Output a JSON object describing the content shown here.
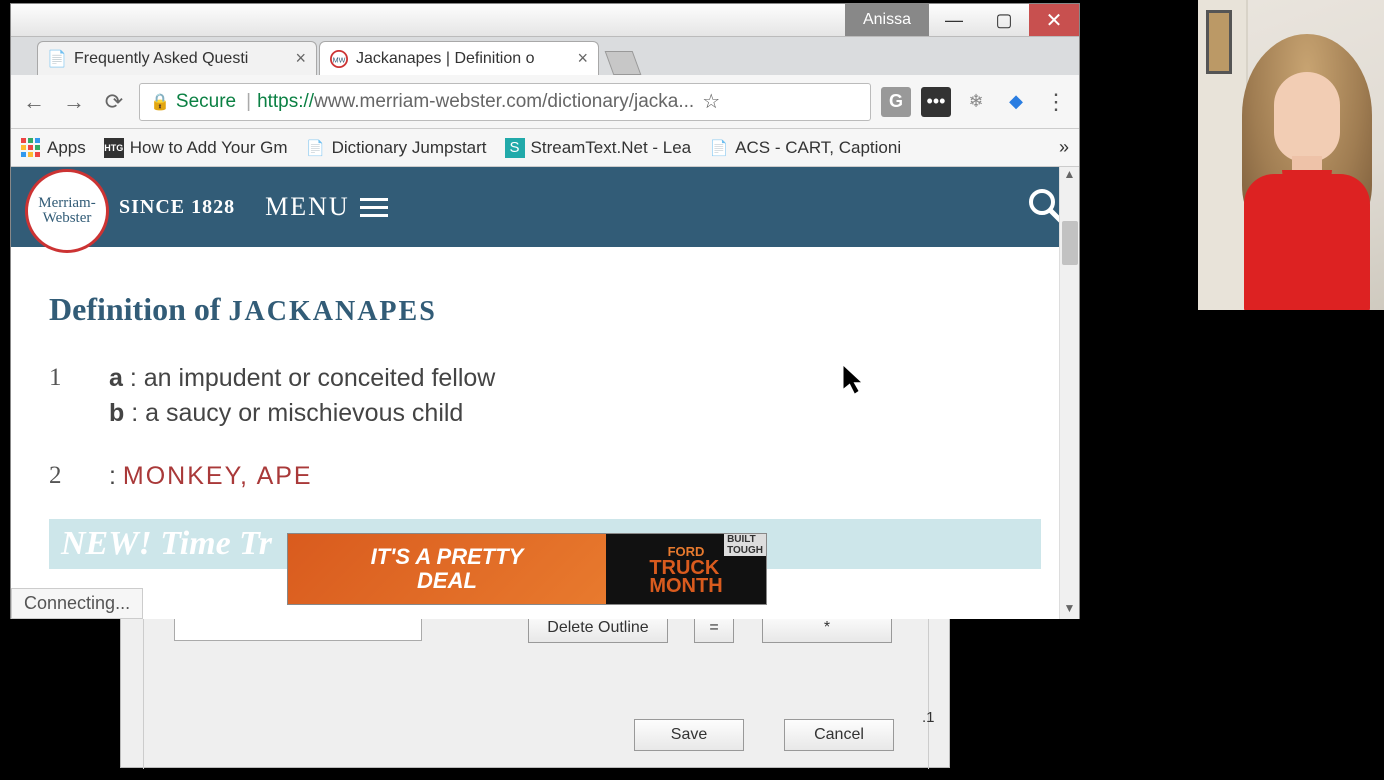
{
  "titlebar": {
    "profile": "Anissa"
  },
  "tabs": [
    {
      "label": "Frequently Asked Questi",
      "active": false
    },
    {
      "label": "Jackanapes | Definition o",
      "active": true
    }
  ],
  "address": {
    "secure_label": "Secure",
    "protocol": "https://",
    "url_rest": "www.merriam-webster.com/dictionary/jacka..."
  },
  "bookmarks": {
    "apps": "Apps",
    "items": [
      "How to Add Your Gm",
      "Dictionary Jumpstart",
      "StreamText.Net - Lea",
      "ACS - CART, Captioni"
    ]
  },
  "mw": {
    "logo_top": "Merriam-",
    "logo_bottom": "Webster",
    "since": "SINCE 1828",
    "menu": "MENU"
  },
  "definition": {
    "heading_prefix": "Definition of ",
    "word": "JACKANAPES",
    "senses": [
      {
        "num": "1",
        "subs": [
          {
            "letter": "a",
            "text": "an impudent or conceited fellow"
          },
          {
            "letter": "b",
            "text": "a saucy or mischievous child"
          }
        ]
      },
      {
        "num": "2",
        "links": [
          "MONKEY",
          "APE"
        ]
      }
    ],
    "time_traveler": "NEW! Time Tr"
  },
  "ad": {
    "left_line1": "IT'S A PRETTY",
    "left_line2": "DEAL",
    "brand": "FORD",
    "truck": "TRUCK",
    "month": "MONTH",
    "built": "BUILT",
    "tough": "TOUGH"
  },
  "status": "Connecting...",
  "dialog": {
    "delete": "Delete Outline",
    "eq": "=",
    "star": "*",
    "save": "Save",
    "cancel": "Cancel",
    "version": ".1"
  }
}
